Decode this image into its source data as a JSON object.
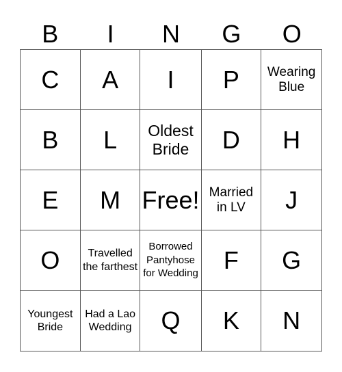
{
  "header": [
    "B",
    "I",
    "N",
    "G",
    "O"
  ],
  "cells": [
    {
      "text": "C",
      "size": "big"
    },
    {
      "text": "A",
      "size": "big"
    },
    {
      "text": "I",
      "size": "big"
    },
    {
      "text": "P",
      "size": "big"
    },
    {
      "text": "Wearing Blue",
      "size": "sm"
    },
    {
      "text": "B",
      "size": "big"
    },
    {
      "text": "L",
      "size": "big"
    },
    {
      "text": "Oldest Bride",
      "size": "med"
    },
    {
      "text": "D",
      "size": "big"
    },
    {
      "text": "H",
      "size": "big"
    },
    {
      "text": "E",
      "size": "big"
    },
    {
      "text": "M",
      "size": "big"
    },
    {
      "text": "Free!",
      "size": "big"
    },
    {
      "text": "Married in LV",
      "size": "sm"
    },
    {
      "text": "J",
      "size": "big"
    },
    {
      "text": "O",
      "size": "big"
    },
    {
      "text": "Travelled the farthest",
      "size": "xs"
    },
    {
      "text": "Borrowed Pantyhose for Wedding",
      "size": "xxs"
    },
    {
      "text": "F",
      "size": "big"
    },
    {
      "text": "G",
      "size": "big"
    },
    {
      "text": "Youngest Bride",
      "size": "xs"
    },
    {
      "text": "Had a Lao Wedding",
      "size": "xs"
    },
    {
      "text": "Q",
      "size": "big"
    },
    {
      "text": "K",
      "size": "big"
    },
    {
      "text": "N",
      "size": "big"
    }
  ]
}
